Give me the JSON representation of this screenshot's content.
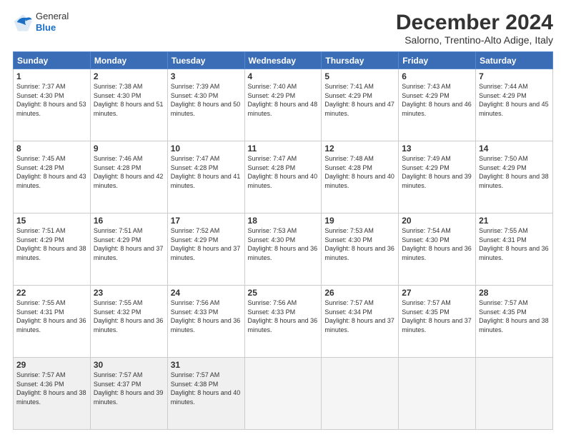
{
  "logo": {
    "general": "General",
    "blue": "Blue"
  },
  "title": "December 2024",
  "subtitle": "Salorno, Trentino-Alto Adige, Italy",
  "weekdays": [
    "Sunday",
    "Monday",
    "Tuesday",
    "Wednesday",
    "Thursday",
    "Friday",
    "Saturday"
  ],
  "weeks": [
    [
      {
        "day": "1",
        "sunrise": "7:37 AM",
        "sunset": "4:30 PM",
        "daylight": "8 hours and 53 minutes."
      },
      {
        "day": "2",
        "sunrise": "7:38 AM",
        "sunset": "4:30 PM",
        "daylight": "8 hours and 51 minutes."
      },
      {
        "day": "3",
        "sunrise": "7:39 AM",
        "sunset": "4:30 PM",
        "daylight": "8 hours and 50 minutes."
      },
      {
        "day": "4",
        "sunrise": "7:40 AM",
        "sunset": "4:29 PM",
        "daylight": "8 hours and 48 minutes."
      },
      {
        "day": "5",
        "sunrise": "7:41 AM",
        "sunset": "4:29 PM",
        "daylight": "8 hours and 47 minutes."
      },
      {
        "day": "6",
        "sunrise": "7:43 AM",
        "sunset": "4:29 PM",
        "daylight": "8 hours and 46 minutes."
      },
      {
        "day": "7",
        "sunrise": "7:44 AM",
        "sunset": "4:29 PM",
        "daylight": "8 hours and 45 minutes."
      }
    ],
    [
      {
        "day": "8",
        "sunrise": "7:45 AM",
        "sunset": "4:28 PM",
        "daylight": "8 hours and 43 minutes."
      },
      {
        "day": "9",
        "sunrise": "7:46 AM",
        "sunset": "4:28 PM",
        "daylight": "8 hours and 42 minutes."
      },
      {
        "day": "10",
        "sunrise": "7:47 AM",
        "sunset": "4:28 PM",
        "daylight": "8 hours and 41 minutes."
      },
      {
        "day": "11",
        "sunrise": "7:47 AM",
        "sunset": "4:28 PM",
        "daylight": "8 hours and 40 minutes."
      },
      {
        "day": "12",
        "sunrise": "7:48 AM",
        "sunset": "4:28 PM",
        "daylight": "8 hours and 40 minutes."
      },
      {
        "day": "13",
        "sunrise": "7:49 AM",
        "sunset": "4:29 PM",
        "daylight": "8 hours and 39 minutes."
      },
      {
        "day": "14",
        "sunrise": "7:50 AM",
        "sunset": "4:29 PM",
        "daylight": "8 hours and 38 minutes."
      }
    ],
    [
      {
        "day": "15",
        "sunrise": "7:51 AM",
        "sunset": "4:29 PM",
        "daylight": "8 hours and 38 minutes."
      },
      {
        "day": "16",
        "sunrise": "7:51 AM",
        "sunset": "4:29 PM",
        "daylight": "8 hours and 37 minutes."
      },
      {
        "day": "17",
        "sunrise": "7:52 AM",
        "sunset": "4:29 PM",
        "daylight": "8 hours and 37 minutes."
      },
      {
        "day": "18",
        "sunrise": "7:53 AM",
        "sunset": "4:30 PM",
        "daylight": "8 hours and 36 minutes."
      },
      {
        "day": "19",
        "sunrise": "7:53 AM",
        "sunset": "4:30 PM",
        "daylight": "8 hours and 36 minutes."
      },
      {
        "day": "20",
        "sunrise": "7:54 AM",
        "sunset": "4:30 PM",
        "daylight": "8 hours and 36 minutes."
      },
      {
        "day": "21",
        "sunrise": "7:55 AM",
        "sunset": "4:31 PM",
        "daylight": "8 hours and 36 minutes."
      }
    ],
    [
      {
        "day": "22",
        "sunrise": "7:55 AM",
        "sunset": "4:31 PM",
        "daylight": "8 hours and 36 minutes."
      },
      {
        "day": "23",
        "sunrise": "7:55 AM",
        "sunset": "4:32 PM",
        "daylight": "8 hours and 36 minutes."
      },
      {
        "day": "24",
        "sunrise": "7:56 AM",
        "sunset": "4:33 PM",
        "daylight": "8 hours and 36 minutes."
      },
      {
        "day": "25",
        "sunrise": "7:56 AM",
        "sunset": "4:33 PM",
        "daylight": "8 hours and 36 minutes."
      },
      {
        "day": "26",
        "sunrise": "7:57 AM",
        "sunset": "4:34 PM",
        "daylight": "8 hours and 37 minutes."
      },
      {
        "day": "27",
        "sunrise": "7:57 AM",
        "sunset": "4:35 PM",
        "daylight": "8 hours and 37 minutes."
      },
      {
        "day": "28",
        "sunrise": "7:57 AM",
        "sunset": "4:35 PM",
        "daylight": "8 hours and 38 minutes."
      }
    ],
    [
      {
        "day": "29",
        "sunrise": "7:57 AM",
        "sunset": "4:36 PM",
        "daylight": "8 hours and 38 minutes."
      },
      {
        "day": "30",
        "sunrise": "7:57 AM",
        "sunset": "4:37 PM",
        "daylight": "8 hours and 39 minutes."
      },
      {
        "day": "31",
        "sunrise": "7:57 AM",
        "sunset": "4:38 PM",
        "daylight": "8 hours and 40 minutes."
      },
      null,
      null,
      null,
      null
    ]
  ]
}
